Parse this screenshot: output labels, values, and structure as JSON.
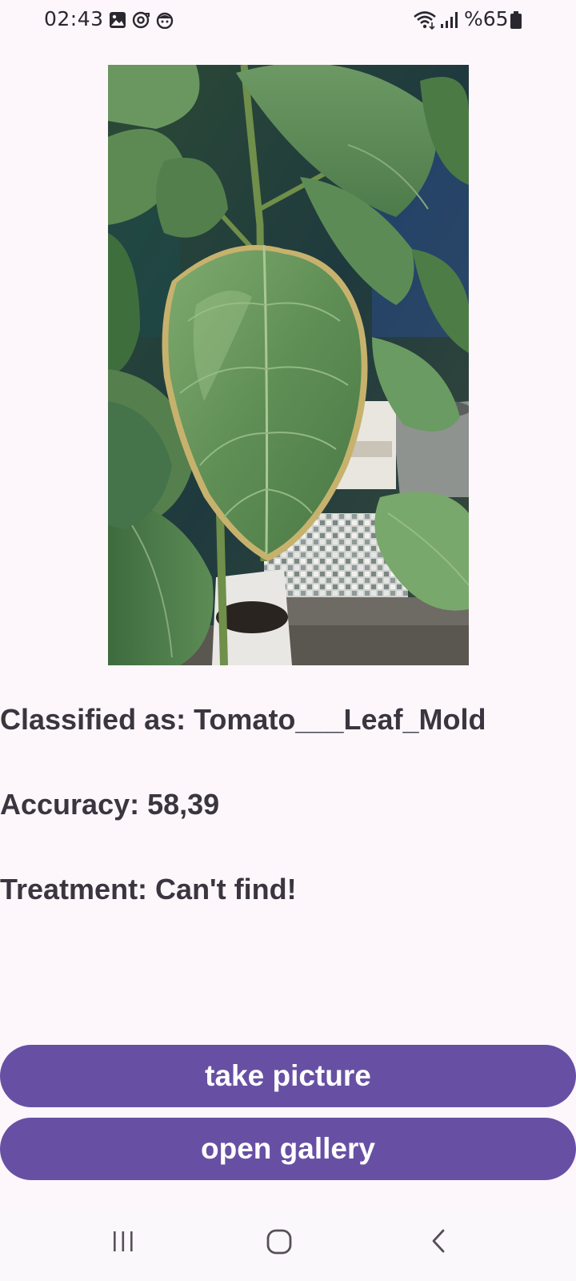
{
  "status_bar": {
    "time": "02:43",
    "battery_text": "%65",
    "icons": [
      "gallery-icon",
      "sync-icon",
      "face-icon",
      "wifi-icon",
      "signal-icon",
      "battery-icon"
    ]
  },
  "photo": {
    "subject": "plant-leaf-photo"
  },
  "result": {
    "classified": "Classified as: Tomato___Leaf_Mold",
    "accuracy": "Accuracy: 58,39",
    "treatment": "Treatment: Can't find!"
  },
  "buttons": {
    "take_picture": "take picture",
    "open_gallery": "open gallery"
  },
  "nav": {
    "icons": [
      "recents-icon",
      "home-icon",
      "back-icon"
    ]
  },
  "colors": {
    "background": "#fdf7fc",
    "button": "#6750a4",
    "button_text": "#ffffff",
    "text": "#3b3540"
  }
}
